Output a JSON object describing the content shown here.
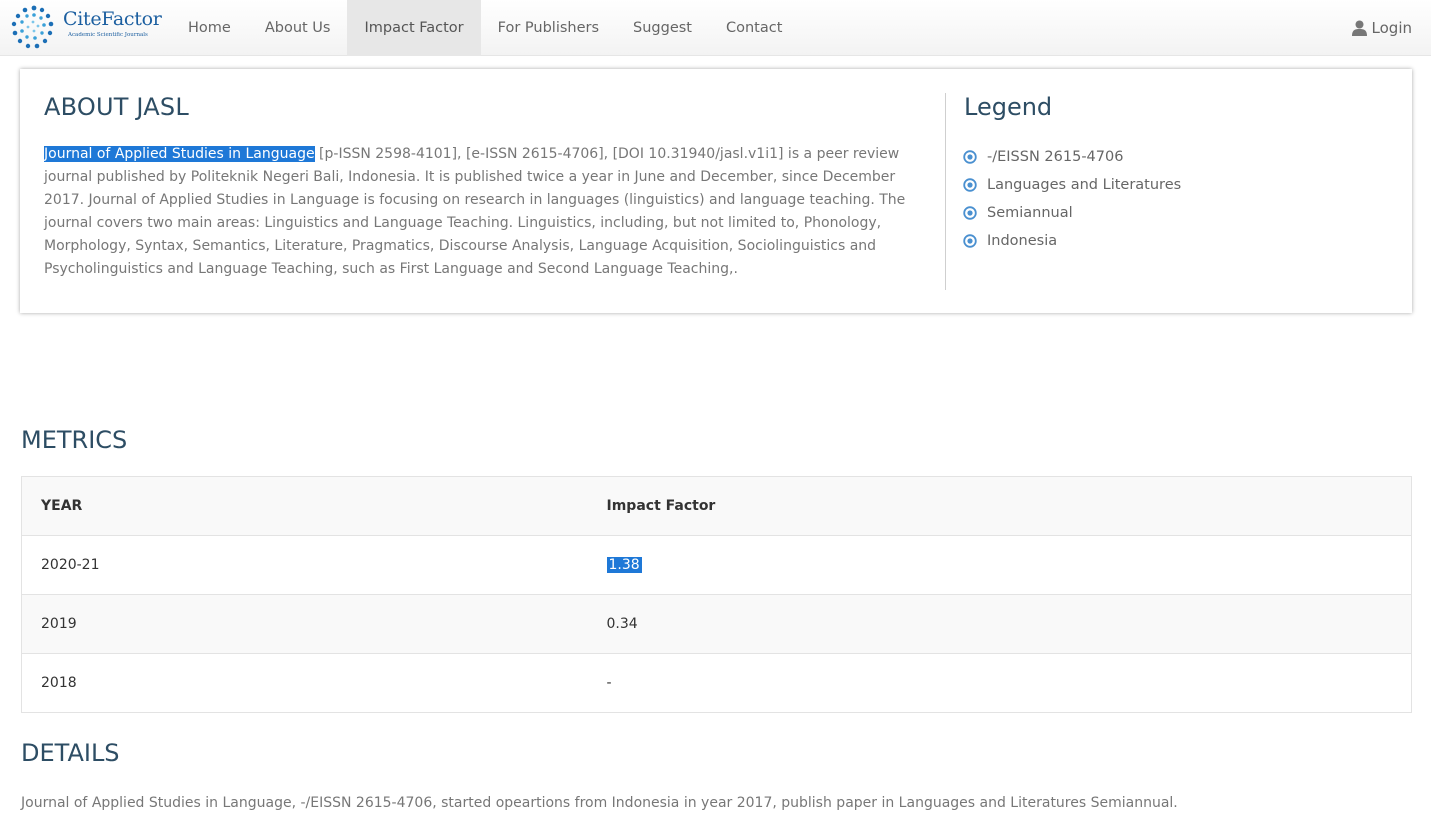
{
  "brand": {
    "name": "CiteFactor",
    "tagline": "Academic Scientific Journals",
    "accent": "#1c5fa0"
  },
  "nav": {
    "items": [
      {
        "label": "Home"
      },
      {
        "label": "About Us"
      },
      {
        "label": "Impact Factor",
        "active": true
      },
      {
        "label": "For Publishers"
      },
      {
        "label": "Suggest"
      },
      {
        "label": "Contact"
      }
    ],
    "login": {
      "icon": "user-icon",
      "label": "Login"
    }
  },
  "about": {
    "title": "ABOUT JASL",
    "journal_name": "Journal of Applied Studies in Language",
    "description": " [p-ISSN 2598-4101], [e-ISSN 2615-4706], [DOI 10.31940/jasl.v1i1] is a peer review journal published by Politeknik Negeri Bali, Indonesia. It is published twice a year in June and December, since December 2017. Journal of Applied Studies in Language is focusing on research in languages (linguistics) and language teaching. The journal covers two main areas: Linguistics and Language Teaching. Linguistics, including, but not limited to, Phonology, Morphology, Syntax, Semantics, Literature, Pragmatics, Discourse Analysis, Language Acquisition, Sociolinguistics and Psycholinguistics and Language Teaching, such as First Language and Second Language Teaching,.",
    "selection_color": "#1e78d7"
  },
  "legend": {
    "title": "Legend",
    "items": [
      {
        "icon": "radio-dot-icon",
        "label": "-/EISSN 2615-4706"
      },
      {
        "icon": "radio-dot-icon",
        "label": "Languages and Literatures"
      },
      {
        "icon": "radio-dot-icon",
        "label": "Semiannual"
      },
      {
        "icon": "radio-dot-icon",
        "label": "Indonesia"
      }
    ]
  },
  "metrics": {
    "title": "METRICS",
    "headers": [
      "YEAR",
      "Impact Factor"
    ],
    "rows": [
      {
        "year": "2020-21",
        "impact_factor": "1.38"
      },
      {
        "year": "2019",
        "impact_factor": "0.34"
      },
      {
        "year": "2018",
        "impact_factor": "-"
      }
    ]
  },
  "details": {
    "title": "DETAILS",
    "text": "Journal of Applied Studies in Language, -/EISSN 2615-4706, started opeartions from Indonesia in year 2017, publish paper in Languages and Literatures Semiannual."
  }
}
